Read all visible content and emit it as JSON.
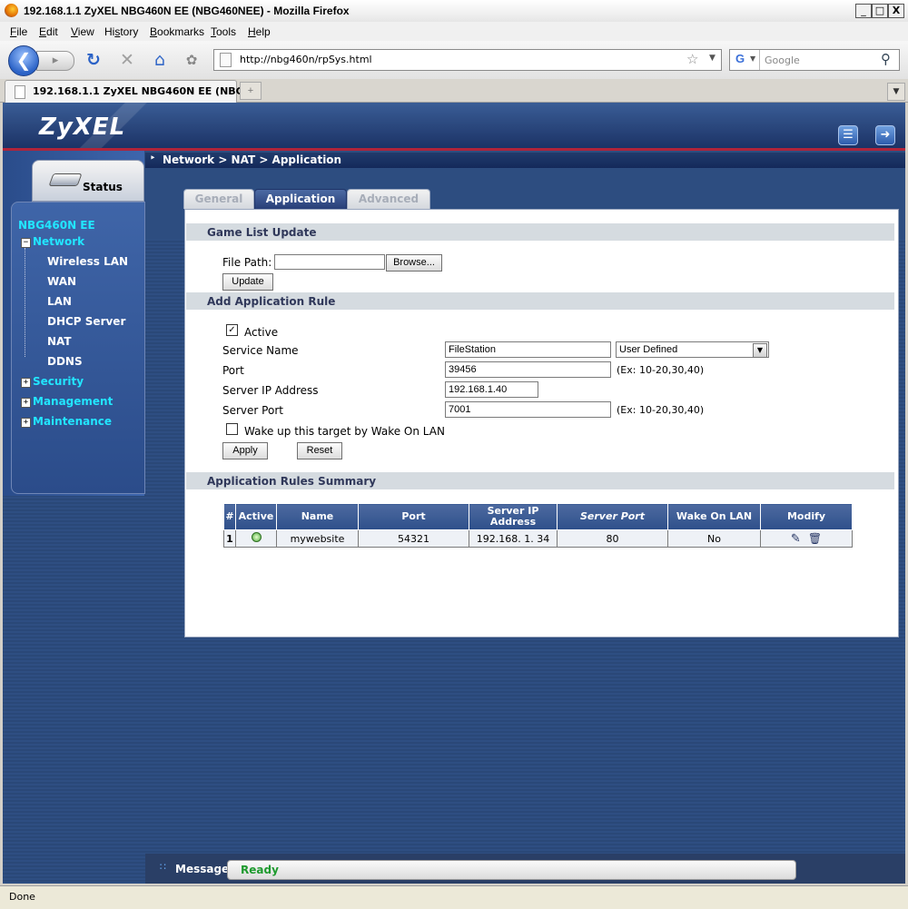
{
  "window": {
    "title": "192.168.1.1 ZyXEL NBG460N EE (NBG460NEE) - Mozilla Firefox",
    "min": "_",
    "max": "□",
    "close": "X"
  },
  "menubar": [
    "File",
    "Edit",
    "View",
    "History",
    "Bookmarks",
    "Tools",
    "Help"
  ],
  "menubar_access": [
    "F",
    "E",
    "V",
    "S",
    "B",
    "T",
    "H"
  ],
  "nav": {
    "url": "http://nbg460n/rpSys.html",
    "search_placeholder": "Google"
  },
  "browser_tab": {
    "title": "192.168.1.1 ZyXEL NBG460N EE (NBG4...",
    "new_tab": "+"
  },
  "brand": "ZyXEL",
  "breadcrumb": "Network > NAT > Application",
  "sidebar": {
    "status_tab": "Status",
    "device": "NBG460N EE",
    "network": "Network",
    "network_items": [
      "Wireless LAN",
      "WAN",
      "LAN",
      "DHCP Server",
      "NAT",
      "DDNS"
    ],
    "security": "Security",
    "management": "Management",
    "maintenance": "Maintenance"
  },
  "tabs": {
    "general": "General",
    "application": "Application",
    "advanced": "Advanced"
  },
  "game_list": {
    "heading": "Game List Update",
    "file_path_label": "File Path:",
    "file_path_value": "",
    "browse": "Browse...",
    "update": "Update"
  },
  "add_rule": {
    "heading": "Add Application Rule",
    "active_label": "Active",
    "active_checked": true,
    "service_name_label": "Service Name",
    "service_name_value": "FileStation",
    "service_select": "User Defined",
    "port_label": "Port",
    "port_value": "39456",
    "port_hint": "(Ex: 10-20,30,40)",
    "server_ip_label": "Server IP Address",
    "server_ip_value": "192.168.1.40",
    "server_port_label": "Server Port",
    "server_port_value": "7001",
    "server_port_hint": "(Ex: 10-20,30,40)",
    "wol_label": "Wake up this target by Wake On LAN",
    "wol_checked": false,
    "apply": "Apply",
    "reset": "Reset"
  },
  "summary": {
    "heading": "Application Rules Summary",
    "columns": [
      "#",
      "Active",
      "Name",
      "Port",
      "Server IP Address",
      "Server Port",
      "Wake On LAN",
      "Modify"
    ],
    "rows": [
      {
        "num": "1",
        "active": "on",
        "name": "mywebsite",
        "port": "54321",
        "server_ip": "192.168. 1. 34",
        "server_port": "80",
        "wol": "No"
      }
    ]
  },
  "message": {
    "label": "Message",
    "value": "Ready"
  },
  "statusbar": "Done"
}
